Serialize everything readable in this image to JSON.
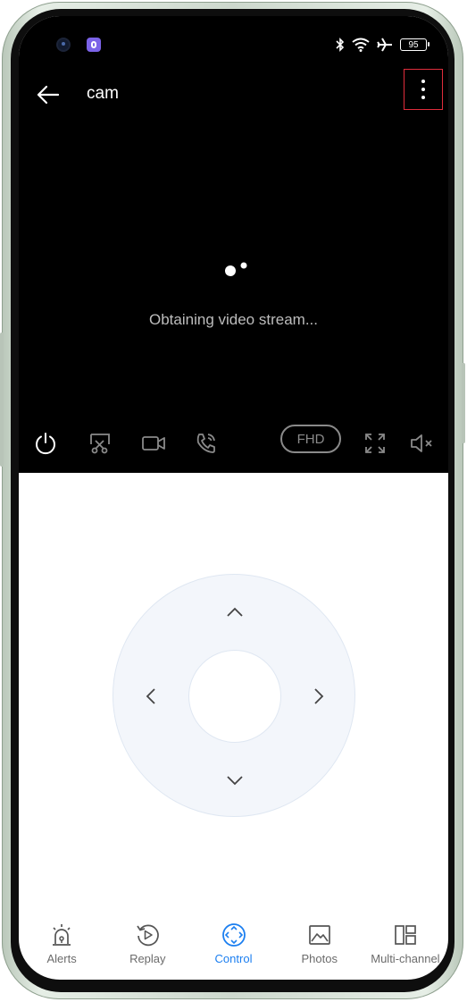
{
  "status_bar": {
    "battery": "95"
  },
  "header": {
    "title": "cam"
  },
  "video": {
    "message": "Obtaining video stream..."
  },
  "toolbar": {
    "quality": "FHD"
  },
  "tabs": [
    {
      "label": "Alerts",
      "icon": "alarm-icon"
    },
    {
      "label": "Replay",
      "icon": "replay-icon"
    },
    {
      "label": "Control",
      "icon": "control-icon",
      "active": true
    },
    {
      "label": "Photos",
      "icon": "photos-icon"
    },
    {
      "label": "Multi-channel",
      "icon": "multi-channel-icon"
    }
  ],
  "colors": {
    "accent": "#1c7ff0",
    "highlight_border": "#e02d3c",
    "video_bg": "#000000"
  }
}
